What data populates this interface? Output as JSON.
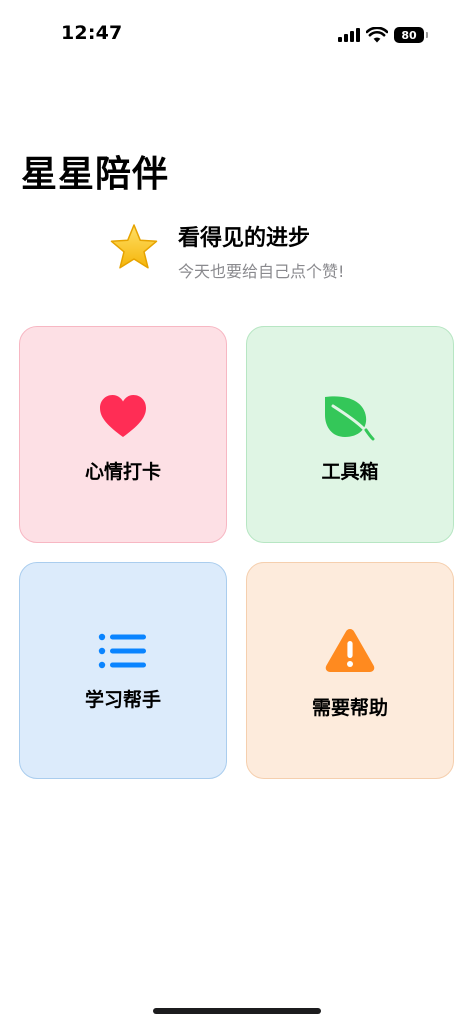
{
  "status_bar": {
    "time": "12:47",
    "battery": "80"
  },
  "app": {
    "title": "星星陪伴"
  },
  "banner": {
    "title": "看得见的进步",
    "subtitle": "今天也要给自己点个赞!",
    "icon": "star-icon"
  },
  "cards": [
    {
      "label": "心情打卡",
      "icon": "heart-icon",
      "accent": "#ff2d55",
      "bg": "#fde0e5"
    },
    {
      "label": "工具箱",
      "icon": "leaf-icon",
      "accent": "#34c759",
      "bg": "#dff5e4"
    },
    {
      "label": "学习帮手",
      "icon": "list-icon",
      "accent": "#0a84ff",
      "bg": "#dcebfb"
    },
    {
      "label": "需要帮助",
      "icon": "warning-icon",
      "accent": "#ff8a1f",
      "bg": "#fdebdc"
    }
  ]
}
